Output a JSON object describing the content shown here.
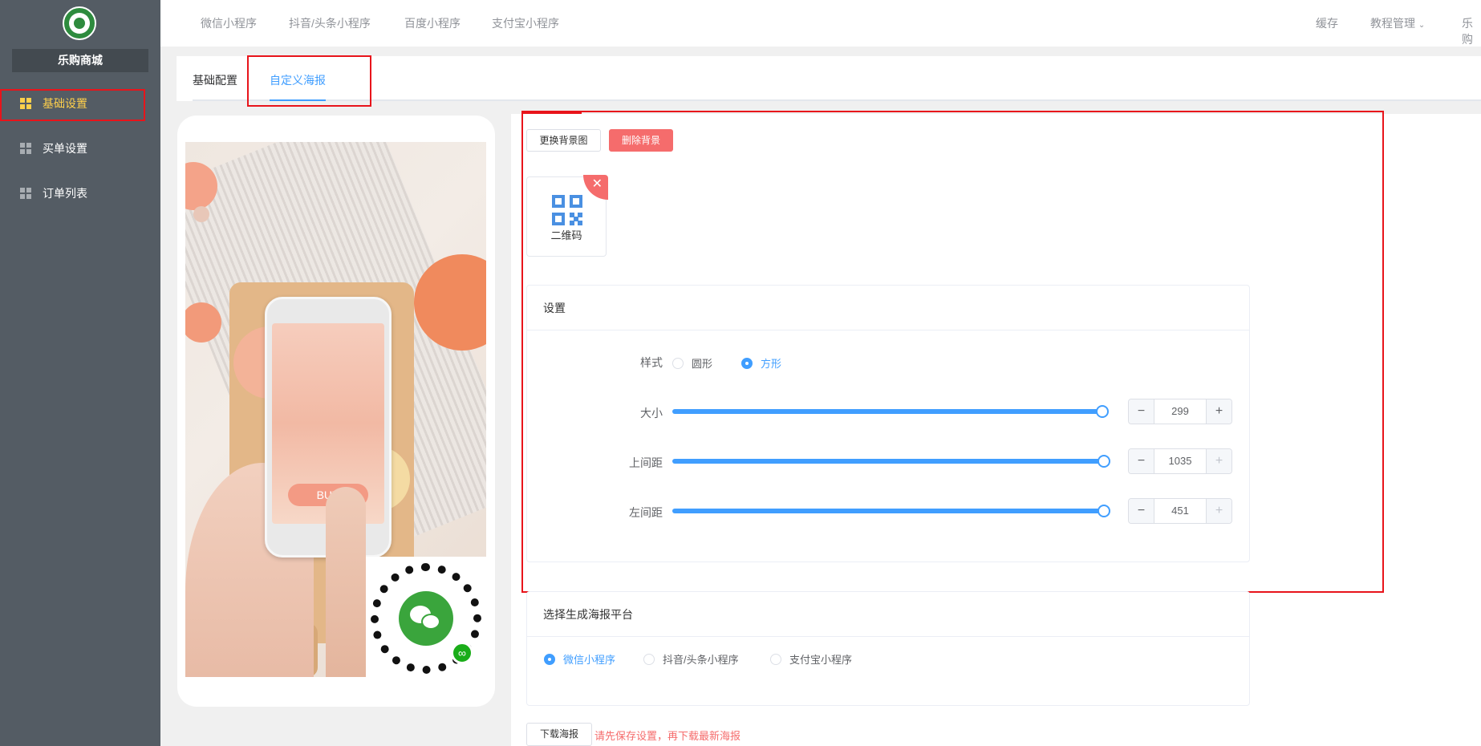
{
  "sidebar": {
    "shop_name": "乐购商城",
    "items": [
      {
        "label": "基础设置",
        "active": true
      },
      {
        "label": "买单设置",
        "active": false
      },
      {
        "label": "订单列表",
        "active": false
      }
    ]
  },
  "topbar": {
    "platforms": [
      "微信小程序",
      "抖音/头条小程序",
      "百度小程序",
      "支付宝小程序"
    ],
    "cache": "缓存",
    "tutorial": "教程管理",
    "user": "乐购"
  },
  "tabs": [
    {
      "label": "基础配置",
      "active": false
    },
    {
      "label": "自定义海报",
      "active": true
    }
  ],
  "preview": {
    "buy_label": "BUY"
  },
  "editor": {
    "change_bg_label": "更换背景图",
    "delete_bg_label": "删除背景",
    "qr_label": "二维码",
    "settings_title": "设置",
    "style_label": "样式",
    "style_options": [
      {
        "label": "圆形",
        "selected": false
      },
      {
        "label": "方形",
        "selected": true
      }
    ],
    "size": {
      "label": "大小",
      "value": "299",
      "fraction": 1.0
    },
    "top": {
      "label": "上间距",
      "value": "1035",
      "fraction": 1.0
    },
    "left": {
      "label": "左间距",
      "value": "451",
      "fraction": 1.0
    }
  },
  "platform_select": {
    "title": "选择生成海报平台",
    "options": [
      {
        "label": "微信小程序",
        "selected": true
      },
      {
        "label": "抖音/头条小程序",
        "selected": false
      },
      {
        "label": "支付宝小程序",
        "selected": false
      }
    ]
  },
  "download": {
    "button_label": "下载海报",
    "hint": "请先保存设置，再下载最新海报"
  },
  "colors": {
    "sidebar_bg": "#545c64",
    "active_nav": "#ffd04b",
    "primary": "#409eff",
    "danger": "#f56c6c"
  }
}
